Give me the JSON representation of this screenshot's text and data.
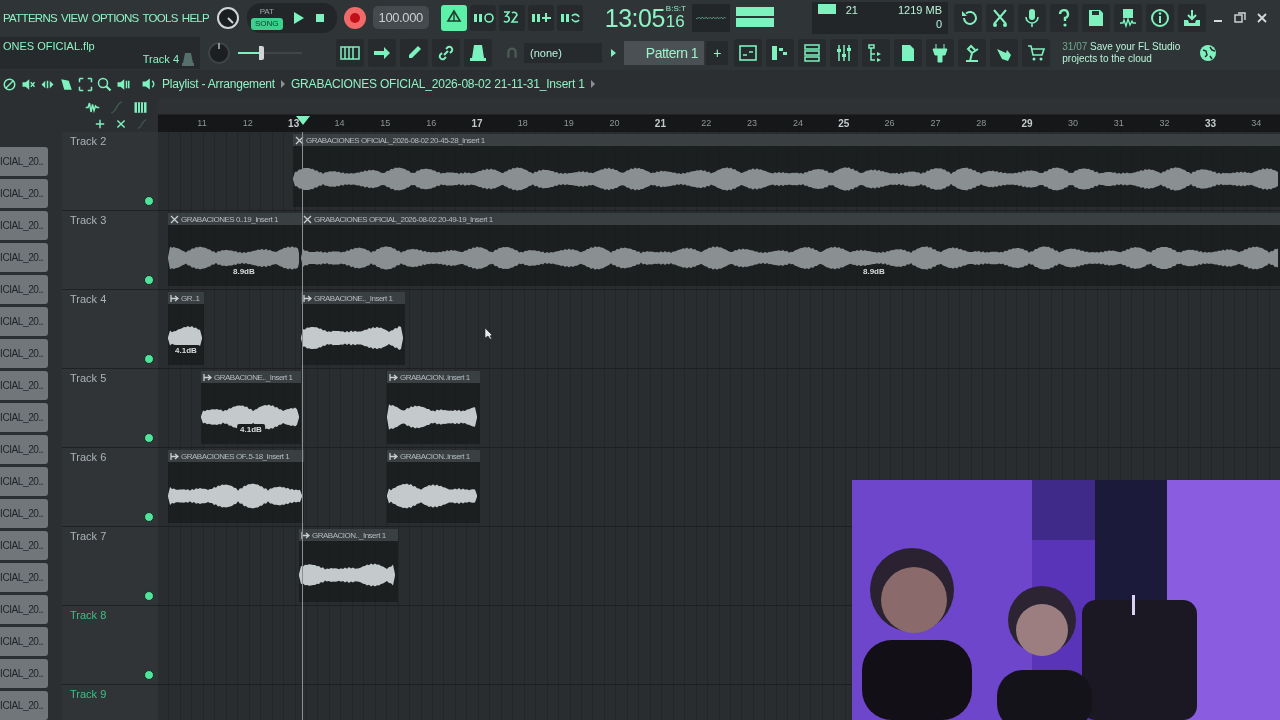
{
  "menu": [
    "PATTERNS",
    "VIEW",
    "OPTIONS",
    "TOOLS",
    "HELP"
  ],
  "project": {
    "file": "ONES OFICIAL.flp",
    "channel": "Track 4"
  },
  "master_volume": {
    "level": 0.4
  },
  "transport": {
    "modes": [
      {
        "label": "PAT",
        "selected": false
      },
      {
        "label": "SONG",
        "selected": true
      }
    ],
    "recording": true,
    "tempo": "100.000"
  },
  "toggles": [
    {
      "selected": true
    },
    {
      "selected": false
    },
    {
      "selected": false
    },
    {
      "selected": false
    },
    {
      "selected": false
    }
  ],
  "clock": {
    "time": "13:05",
    "ticks": "16",
    "format": "B:S:T"
  },
  "monitor": {
    "cpu": "21",
    "memory": "1219 MB",
    "polyphony": "0"
  },
  "snap": "(none)",
  "pattern": {
    "name": "Pattern 1",
    "add": "+"
  },
  "hint": {
    "date": "31/07",
    "text": "Save your FL Studio projects to the cloud"
  },
  "playlist": {
    "title": "Playlist - Arrangement",
    "clip": "GRABACIONES OFICIAL_2026-08-02 21-11-31_Insert 1"
  },
  "ruler": [
    {
      "label": "11",
      "bold": false
    },
    {
      "label": "12",
      "bold": false
    },
    {
      "label": "13",
      "bold": true
    },
    {
      "label": "14",
      "bold": false
    },
    {
      "label": "15",
      "bold": false
    },
    {
      "label": "16",
      "bold": false
    },
    {
      "label": "17",
      "bold": true
    },
    {
      "label": "18",
      "bold": false
    },
    {
      "label": "19",
      "bold": false
    },
    {
      "label": "20",
      "bold": false
    },
    {
      "label": "21",
      "bold": true
    },
    {
      "label": "22",
      "bold": false
    },
    {
      "label": "23",
      "bold": false
    },
    {
      "label": "24",
      "bold": false
    },
    {
      "label": "25",
      "bold": true
    },
    {
      "label": "26",
      "bold": false
    },
    {
      "label": "27",
      "bold": false
    },
    {
      "label": "28",
      "bold": false
    },
    {
      "label": "29",
      "bold": true
    },
    {
      "label": "30",
      "bold": false
    },
    {
      "label": "31",
      "bold": false
    },
    {
      "label": "32",
      "bold": false
    },
    {
      "label": "33",
      "bold": true
    },
    {
      "label": "34",
      "bold": false
    }
  ],
  "clip_list": [
    "ICIAL_20..",
    "ICIAL_20..",
    "ICIAL_20..",
    "ICIAL_20..",
    "ICIAL_20..",
    "ICIAL_20..",
    "ICIAL_20..",
    "ICIAL_20..",
    "ICIAL_20..",
    "ICIAL_20..",
    "ICIAL_20..",
    "ICIAL_20..",
    "ICIAL_20..",
    "ICIAL_20..",
    "ICIAL_20..",
    "ICIAL_20..",
    "ICIAL_20..",
    "ICIAL_20.."
  ],
  "tracks": [
    {
      "name": "Track 2",
      "highlighted": false,
      "enabled": true,
      "clips": [
        {
          "kind": "cut",
          "label": "GRABACIONES OFICIAL_2026-08-02 20-45-28_Insert 1"
        }
      ]
    },
    {
      "name": "Track 3",
      "highlighted": false,
      "enabled": true,
      "clips": [
        {
          "kind": "cut",
          "label": "GRABACIONES 0..19_Insert 1",
          "gain": "8.9dB"
        },
        {
          "kind": "cut",
          "label": "GRABACIONES OFICIAL_2026-08-02 20-49-19_Insert 1",
          "gain": "8.9dB"
        }
      ]
    },
    {
      "name": "Track 4",
      "highlighted": false,
      "enabled": true,
      "clips": [
        {
          "kind": "stretch",
          "label": "GR..1",
          "gain": "4.1dB"
        },
        {
          "kind": "stretch",
          "label": "GRABACIONE.._Insert 1"
        }
      ]
    },
    {
      "name": "Track 5",
      "highlighted": false,
      "enabled": true,
      "clips": [
        {
          "kind": "stretch",
          "label": "GRABACIONE.._Insert 1",
          "gain": "4.1dB"
        },
        {
          "kind": "stretch",
          "label": "GRABACION..Insert 1"
        }
      ]
    },
    {
      "name": "Track 6",
      "highlighted": false,
      "enabled": true,
      "clips": [
        {
          "kind": "stretch",
          "label": "GRABACIONES OF..5-18_Insert 1"
        },
        {
          "kind": "stretch",
          "label": "GRABACION..Insert 1"
        }
      ]
    },
    {
      "name": "Track 7",
      "highlighted": false,
      "enabled": true,
      "clips": [
        {
          "kind": "stretch",
          "label": "GRABACION.._Insert 1"
        }
      ]
    },
    {
      "name": "Track 8",
      "highlighted": true,
      "enabled": true
    },
    {
      "name": "Track 9",
      "highlighted": true
    }
  ]
}
